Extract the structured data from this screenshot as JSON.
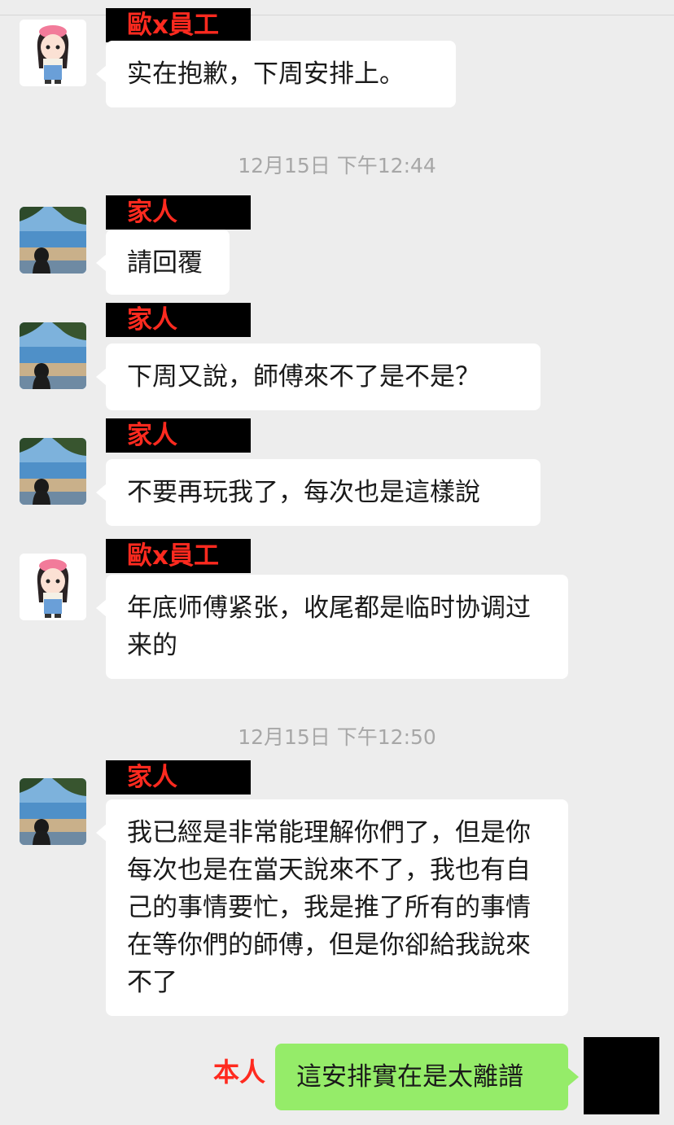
{
  "messages": [
    {
      "sender": "歐x員工",
      "text": "实在抱歉，下周安排上。"
    },
    {
      "timestamp": "12月15日 下午12:44"
    },
    {
      "sender": "家人",
      "text": "請回覆"
    },
    {
      "sender": "家人",
      "text": "下周又說，師傅來不了是不是？"
    },
    {
      "sender": "家人",
      "text": "不要再玩我了，每次也是這樣說"
    },
    {
      "sender": "歐x員工",
      "text": "年底师傅紧张，收尾都是临时协调过来的"
    },
    {
      "timestamp": "12月15日 下午12:50"
    },
    {
      "sender": "家人",
      "text": "我已經是非常能理解你們了，但是你每次也是在當天說來不了，我也有自己的事情要忙，我是推了所有的事情在等你們的師傅，但是你卻給我說來不了"
    },
    {
      "sender": "本人",
      "text": "這安排實在是太離譜",
      "self": true
    }
  ],
  "colors": {
    "background": "#ededed",
    "bubble": "#ffffff",
    "self_bubble": "#95ec69",
    "name_label": "#ff2a1f"
  }
}
